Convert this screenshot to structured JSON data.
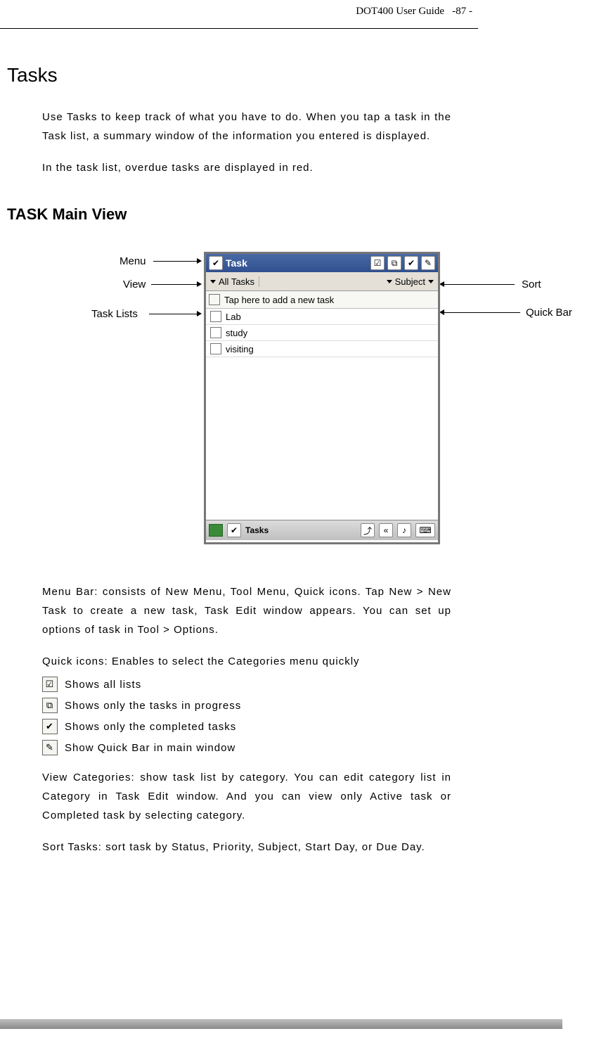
{
  "header": {
    "guide": "DOT400 User Guide",
    "page": "-87 -"
  },
  "h1": "Tasks",
  "p1": "Use Tasks to keep track of what you have to do. When you tap a task in the Task list, a summary window of the information you entered is displayed.",
  "p2": "In the task list, overdue tasks are displayed in red.",
  "h2": "TASK Main View",
  "annotations": {
    "menu": "Menu",
    "view": "View",
    "task_lists": "Task Lists",
    "sort": "Sort",
    "quick_bar": "Quick Bar"
  },
  "pda": {
    "title": "Task",
    "filter_view": "All Tasks",
    "filter_sort": "Subject",
    "quick_hint": "Tap here to add a new task",
    "rows": [
      "Lab",
      "study",
      "visiting"
    ],
    "taskbar_label": "Tasks"
  },
  "menu_bar_text": "Menu Bar: consists of New Menu, Tool Menu, Quick icons. Tap New > New Task to create a new task, Task Edit window appears. You can set up options of task in Tool > Options.",
  "quick_icons_text": "Quick icons: Enables to select the Categories menu quickly",
  "icons": [
    {
      "glyph": "☑",
      "text": "Shows all lists"
    },
    {
      "glyph": "⧉",
      "text": "Shows only the tasks in progress"
    },
    {
      "glyph": "✔",
      "text": "Shows only the completed tasks"
    },
    {
      "glyph": "✎",
      "text": "Show Quick Bar in main window"
    }
  ],
  "view_cat_text": "View Categories: show task list by category. You can edit category list in Category in Task Edit window. And you can view only Active task or Completed task by selecting category.",
  "sort_tasks_text": "Sort Tasks: sort task by Status, Priority, Subject, Start Day, or Due Day."
}
